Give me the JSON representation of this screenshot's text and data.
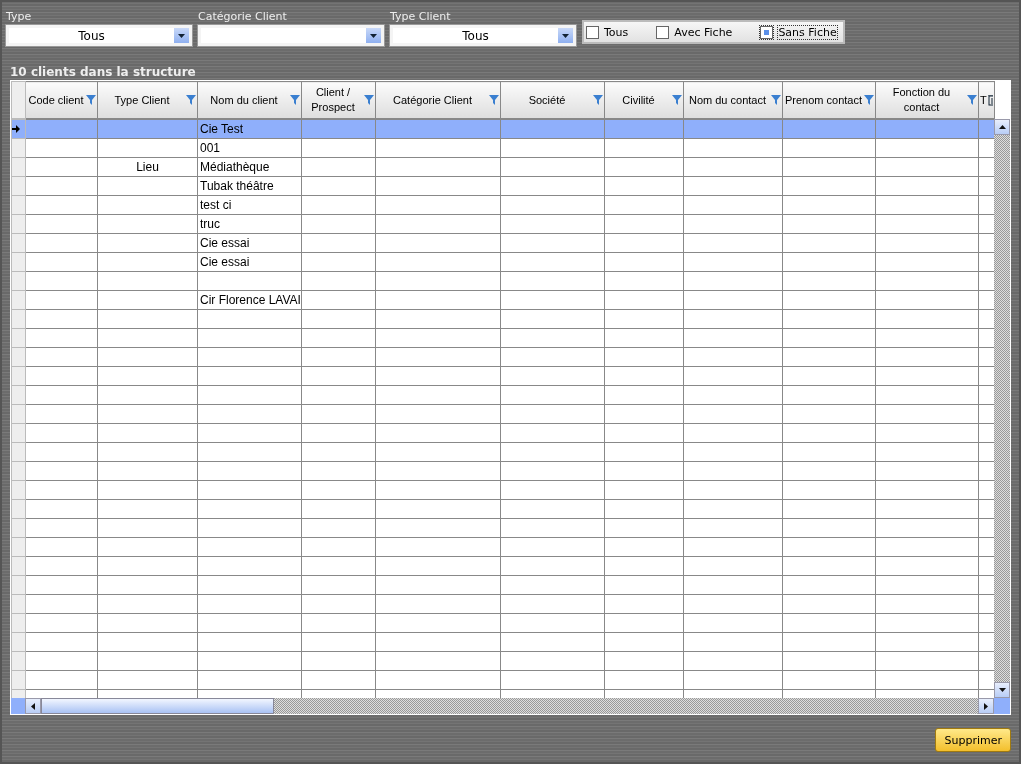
{
  "filters": [
    {
      "label": "Type",
      "value": "Tous"
    },
    {
      "label": "Catégorie Client"
    },
    {
      "label": "Type Client",
      "value": "Tous"
    }
  ],
  "fiche_options": [
    {
      "label": "Tous",
      "checked": false
    },
    {
      "label": "Avec Fiche",
      "checked": false
    },
    {
      "label": "Sans Fiche",
      "checked": true
    }
  ],
  "table": {
    "title": "10 clients dans la structure",
    "columns": [
      "Code client",
      "Type Client",
      "Nom du client",
      "Client / Prospect",
      "Catégorie Client",
      "Société",
      "Civilité",
      "Nom du contact",
      "Prenom contact",
      "Fonction du contact",
      "T"
    ],
    "rows": [
      {
        "selected": true,
        "cells": [
          "",
          "",
          "Cie Test"
        ]
      },
      {
        "selected": false,
        "cells": [
          "",
          "",
          "001"
        ]
      },
      {
        "selected": false,
        "cells": [
          "",
          "Lieu",
          "Médiathèque"
        ]
      },
      {
        "selected": false,
        "cells": [
          "",
          "",
          "Tubak théâtre"
        ]
      },
      {
        "selected": false,
        "cells": [
          "",
          "",
          "test ci"
        ]
      },
      {
        "selected": false,
        "cells": [
          "",
          "",
          "truc"
        ]
      },
      {
        "selected": false,
        "cells": [
          "",
          "",
          "Cie essai"
        ]
      },
      {
        "selected": false,
        "cells": [
          "",
          "",
          "Cie essai"
        ]
      },
      {
        "selected": false,
        "cells": [
          "",
          "",
          ""
        ]
      },
      {
        "selected": false,
        "cells": [
          "",
          "",
          "Cir Florence LAVAI"
        ]
      }
    ]
  },
  "buttons": [
    "Supprimer"
  ]
}
